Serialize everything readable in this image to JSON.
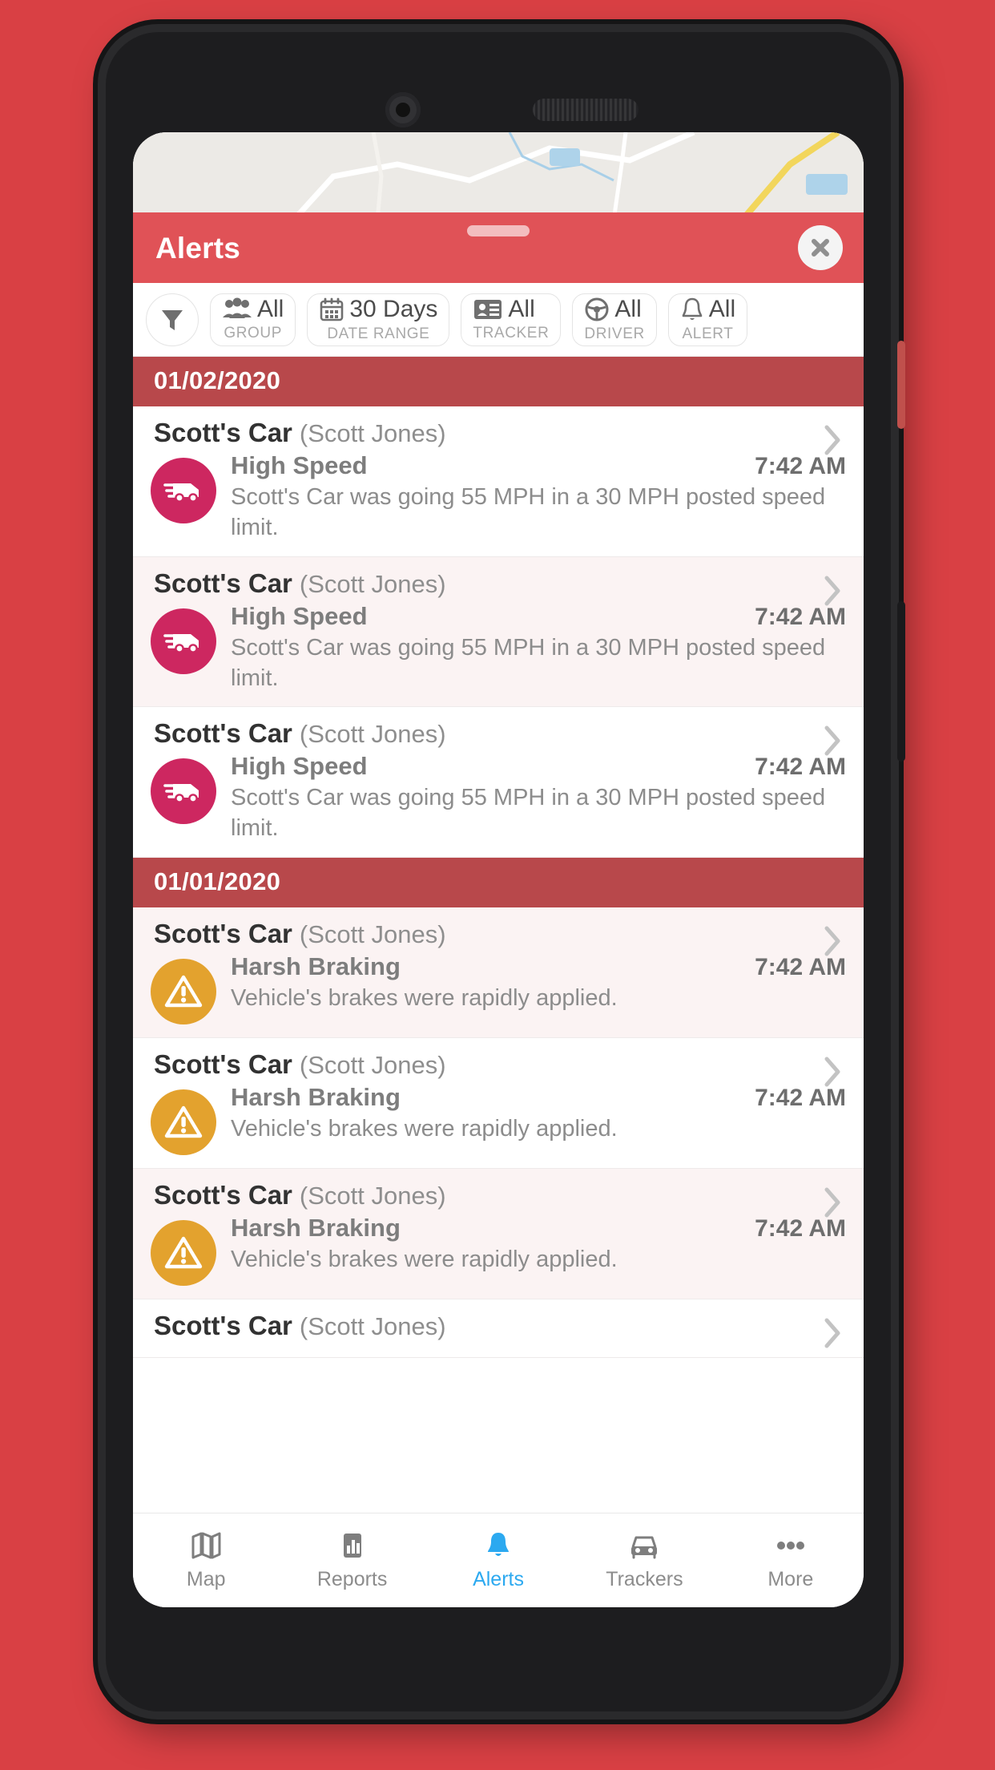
{
  "colors": {
    "background_red": "#d94044",
    "header_red": "#e05257",
    "date_header_red": "#b8484b",
    "speeding_icon": "#cd2760",
    "harsh_braking_icon": "#e3a22e",
    "active_nav_blue": "#2ca9f0",
    "row_tint": "#fbf3f3"
  },
  "sheet": {
    "title": "Alerts",
    "close_icon": "close-icon",
    "grabber": "drag-handle"
  },
  "filter_bar": {
    "filter_icon": "funnel-icon",
    "chips": [
      {
        "icon": "group-people-icon",
        "value": "All",
        "label": "GROUP"
      },
      {
        "icon": "calendar-icon",
        "value": "30 Days",
        "label": "DATE RANGE"
      },
      {
        "icon": "id-card-icon",
        "value": "All",
        "label": "TRACKER"
      },
      {
        "icon": "steering-wheel-icon",
        "value": "All",
        "label": "DRIVER"
      },
      {
        "icon": "bell-icon",
        "value": "All",
        "label": "ALERT"
      }
    ]
  },
  "groups": [
    {
      "date": "01/02/2020",
      "rows": [
        {
          "vehicle": "Scott's Car",
          "driver": "(Scott Jones)",
          "alert_type": "High Speed",
          "time": "7:42 AM",
          "description": "Scott's Car was going 55 MPH in a 30 MPH posted speed limit.",
          "icon": "speeding-vehicle-icon",
          "icon_class": "speeding",
          "tinted": false
        },
        {
          "vehicle": "Scott's Car",
          "driver": "(Scott Jones)",
          "alert_type": "High Speed",
          "time": "7:42 AM",
          "description": "Scott's Car was going 55 MPH in a 30 MPH posted speed limit.",
          "icon": "speeding-vehicle-icon",
          "icon_class": "speeding",
          "tinted": true
        },
        {
          "vehicle": "Scott's Car",
          "driver": "(Scott Jones)",
          "alert_type": "High Speed",
          "time": "7:42 AM",
          "description": "Scott's Car was going 55 MPH in a 30 MPH posted speed limit.",
          "icon": "speeding-vehicle-icon",
          "icon_class": "speeding",
          "tinted": false
        }
      ]
    },
    {
      "date": "01/01/2020",
      "rows": [
        {
          "vehicle": "Scott's Car",
          "driver": "(Scott Jones)",
          "alert_type": "Harsh Braking",
          "time": "7:42 AM",
          "description": "Vehicle's brakes were rapidly applied.",
          "icon": "warning-triangle-icon",
          "icon_class": "harsh-braking",
          "tinted": true
        },
        {
          "vehicle": "Scott's Car",
          "driver": "(Scott Jones)",
          "alert_type": "Harsh Braking",
          "time": "7:42 AM",
          "description": "Vehicle's brakes were rapidly applied.",
          "icon": "warning-triangle-icon",
          "icon_class": "harsh-braking",
          "tinted": false
        },
        {
          "vehicle": "Scott's Car",
          "driver": "(Scott Jones)",
          "alert_type": "Harsh Braking",
          "time": "7:42 AM",
          "description": "Vehicle's brakes were rapidly applied.",
          "icon": "warning-triangle-icon",
          "icon_class": "harsh-braking",
          "tinted": true
        },
        {
          "vehicle": "Scott's Car",
          "driver": "(Scott Jones)",
          "alert_type": "",
          "time": "",
          "description": "",
          "icon": "",
          "icon_class": "",
          "tinted": false,
          "partial": true
        }
      ]
    }
  ],
  "bottom_nav": {
    "items": [
      {
        "icon": "map-icon",
        "label": "Map",
        "active": false
      },
      {
        "icon": "bar-chart-icon",
        "label": "Reports",
        "active": false
      },
      {
        "icon": "bell-icon",
        "label": "Alerts",
        "active": true
      },
      {
        "icon": "car-icon",
        "label": "Trackers",
        "active": false
      },
      {
        "icon": "ellipsis-icon",
        "label": "More",
        "active": false
      }
    ]
  }
}
